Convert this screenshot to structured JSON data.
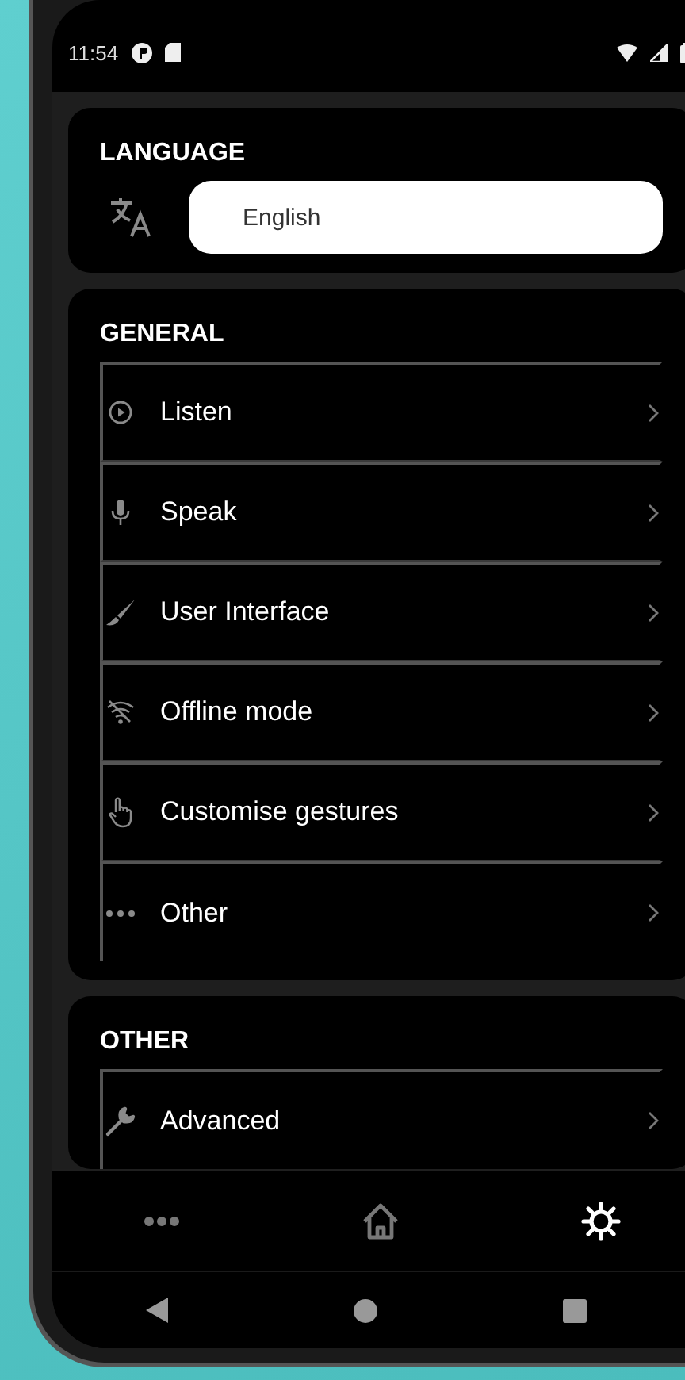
{
  "status_bar": {
    "time": "11:54"
  },
  "language": {
    "title": "LANGUAGE",
    "value": "English"
  },
  "general": {
    "title": "GENERAL",
    "items": [
      {
        "label": "Listen",
        "kind": "play"
      },
      {
        "label": "Speak",
        "kind": "mic"
      },
      {
        "label": "User Interface",
        "kind": "brush"
      },
      {
        "label": "Offline mode",
        "kind": "wifi-off"
      },
      {
        "label": "Customise gestures",
        "kind": "hand"
      },
      {
        "label": "Other",
        "kind": "dots"
      }
    ]
  },
  "other": {
    "title": "OTHER",
    "items": [
      {
        "label": "Advanced",
        "kind": "wrench"
      }
    ]
  },
  "bottom_nav": [
    {
      "kind": "more",
      "selected": false
    },
    {
      "kind": "home",
      "selected": false
    },
    {
      "kind": "settings",
      "selected": true
    }
  ]
}
